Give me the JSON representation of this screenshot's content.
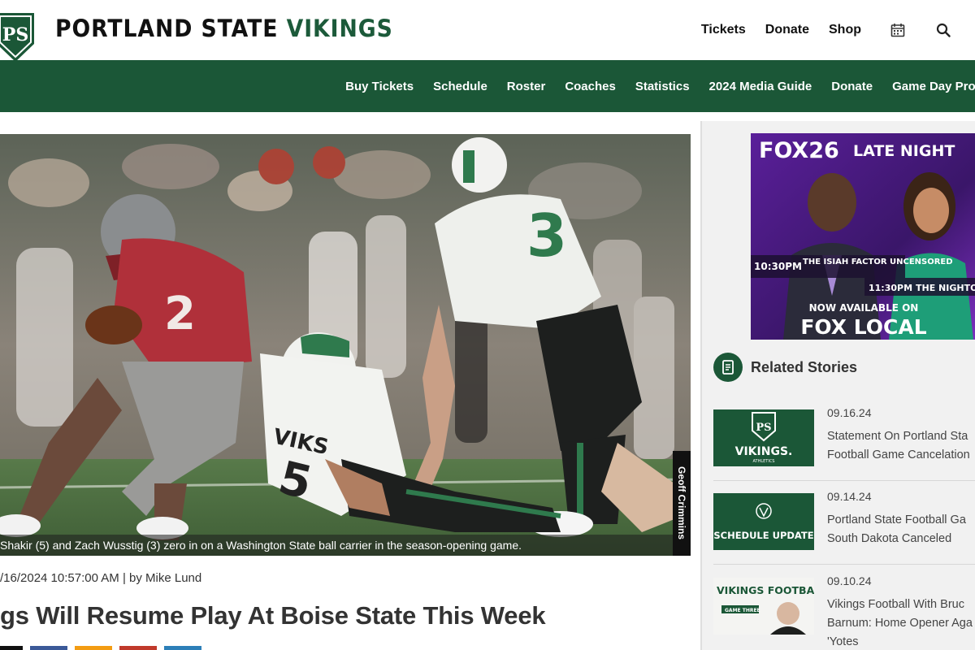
{
  "header": {
    "brand_main": "PORTLAND STATE ",
    "brand_accent": "VIKINGS",
    "logo_letters": "PS",
    "utility_links": [
      "Tickets",
      "Donate",
      "Shop"
    ],
    "colors": {
      "brand_green": "#1b5737",
      "text_dark": "#111111"
    }
  },
  "nav": {
    "items": [
      "Buy Tickets",
      "Schedule",
      "Roster",
      "Coaches",
      "Statistics",
      "2024 Media Guide",
      "Donate",
      "Game Day Progra"
    ]
  },
  "hero": {
    "caption": "Shakir (5) and Zach Wusstig (3) zero in on a Washington State ball carrier in the season-opening game.",
    "photo_credit": "Geoff Crimmins",
    "jersey_left": "2",
    "jersey_right": "3",
    "jersey_front": "VIKS",
    "jersey_front_number": "5"
  },
  "article": {
    "byline": "/16/2024 10:57:00 AM | by Mike Lund",
    "headline": "gs Will Resume Play At Boise State This Week",
    "share_colors": [
      "#111111",
      "#3b5998",
      "#f39c12",
      "#c0392b",
      "#2c7fb8"
    ]
  },
  "ad": {
    "brand": "FOX26",
    "title": "LATE NIGHT",
    "tag1_time": "10:30PM",
    "tag1_text": "THE ISIAH FACTOR UNCENSORED",
    "tag2_time": "11:30PM",
    "tag2_text": "THE NIGHTO",
    "available": "NOW AVAILABLE ON",
    "local_brand": "FOX LOCAL"
  },
  "related": {
    "title": "Related Stories",
    "stories": [
      {
        "date": "09.16.24",
        "title": "Statement On Portland Sta Football Game Cancelation",
        "thumb_text": "VIKINGS.",
        "thumb_sub": "ATHLETICS"
      },
      {
        "date": "09.14.24",
        "title": "Portland State Football Ga South Dakota Canceled",
        "thumb_text": "SCHEDULE UPDATE"
      },
      {
        "date": "09.10.24",
        "title": "Vikings Football With Bruc Barnum: Home Opener Aga 'Yotes",
        "thumb_text": "VIKINGS FOOTBALL",
        "thumb_sub": "GAME THREE"
      }
    ]
  },
  "icons": [
    "calendar-icon",
    "search-icon",
    "document-icon"
  ]
}
